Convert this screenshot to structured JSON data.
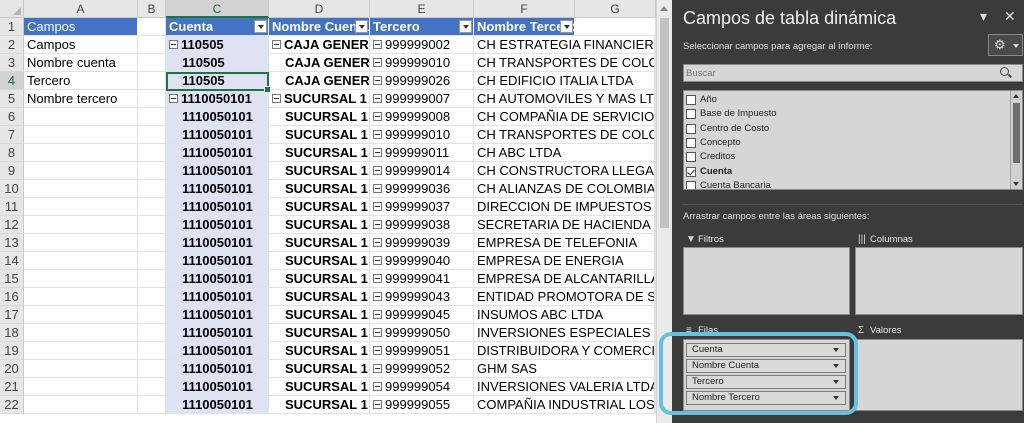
{
  "sheet": {
    "columns": [
      "A",
      "B",
      "C",
      "D",
      "E",
      "F",
      "G"
    ],
    "rows": [
      "1",
      "2",
      "3",
      "4",
      "5",
      "6",
      "7",
      "8",
      "9",
      "10",
      "11",
      "12",
      "13",
      "14",
      "15",
      "16",
      "17",
      "18",
      "19",
      "20",
      "21",
      "22"
    ],
    "selected_column": "C",
    "selected_row": "4",
    "colA": [
      "Campos",
      "Campos",
      "Nombre cuenta",
      "Tercero",
      "Nombre tercero"
    ],
    "pivot_headers": {
      "cuenta": "Cuenta",
      "nombre_cuenta": "Nombre Cuenta",
      "tercero": "Tercero",
      "nombre_tercero": "Nombre Tercero"
    },
    "pivot_rows": [
      {
        "cuenta": "110505",
        "nombre_cuenta": "CAJA GENERAL",
        "tercero": "999999002",
        "nombre_tercero": "CH ESTRATEGIA FINANCIERA S.A.S"
      },
      {
        "cuenta": "110505",
        "nombre_cuenta": "CAJA GENERAL",
        "tercero": "999999010",
        "nombre_tercero": "CH TRANSPORTES DE COLOMBIA"
      },
      {
        "cuenta": "110505",
        "nombre_cuenta": "CAJA GENERAL",
        "tercero": "999999026",
        "nombre_tercero": "CH EDIFICIO ITALIA LTDA"
      },
      {
        "cuenta": "1110050101",
        "nombre_cuenta": "SUCURSAL 1",
        "tercero": "999999007",
        "nombre_tercero": "CH AUTOMOVILES Y MAS LTDA"
      },
      {
        "cuenta": "1110050101",
        "nombre_cuenta": "SUCURSAL 1",
        "tercero": "999999008",
        "nombre_tercero": "CH COMPAÑIA DE SERVICIOS AEREOS"
      },
      {
        "cuenta": "1110050101",
        "nombre_cuenta": "SUCURSAL 1",
        "tercero": "999999010",
        "nombre_tercero": "CH TRANSPORTES DE COLOMBIA"
      },
      {
        "cuenta": "1110050101",
        "nombre_cuenta": "SUCURSAL 1",
        "tercero": "999999011",
        "nombre_tercero": "CH ABC LTDA"
      },
      {
        "cuenta": "1110050101",
        "nombre_cuenta": "SUCURSAL 1",
        "tercero": "999999014",
        "nombre_tercero": "CH CONSTRUCTORA LLEGANDO A"
      },
      {
        "cuenta": "1110050101",
        "nombre_cuenta": "SUCURSAL 1",
        "tercero": "999999036",
        "nombre_tercero": "CH ALIANZAS DE COLOMBIA LTDA"
      },
      {
        "cuenta": "1110050101",
        "nombre_cuenta": "SUCURSAL 1",
        "tercero": "999999037",
        "nombre_tercero": "DIRECCION DE IMPUESTOS Y ADUANAS"
      },
      {
        "cuenta": "1110050101",
        "nombre_cuenta": "SUCURSAL 1",
        "tercero": "999999038",
        "nombre_tercero": "SECRETARIA DE HACIENDA DISTRITAL"
      },
      {
        "cuenta": "1110050101",
        "nombre_cuenta": "SUCURSAL 1",
        "tercero": "999999039",
        "nombre_tercero": "EMPRESA DE TELEFONIA"
      },
      {
        "cuenta": "1110050101",
        "nombre_cuenta": "SUCURSAL 1",
        "tercero": "999999040",
        "nombre_tercero": "EMPRESA DE ENERGIA"
      },
      {
        "cuenta": "1110050101",
        "nombre_cuenta": "SUCURSAL 1",
        "tercero": "999999041",
        "nombre_tercero": "EMPRESA DE ALCANTARILLADO"
      },
      {
        "cuenta": "1110050101",
        "nombre_cuenta": "SUCURSAL 1",
        "tercero": "999999043",
        "nombre_tercero": "ENTIDAD PROMOTORA DE SALUD"
      },
      {
        "cuenta": "1110050101",
        "nombre_cuenta": "SUCURSAL 1",
        "tercero": "999999045",
        "nombre_tercero": "INSUMOS ABC LTDA"
      },
      {
        "cuenta": "1110050101",
        "nombre_cuenta": "SUCURSAL 1",
        "tercero": "999999050",
        "nombre_tercero": "INVERSIONES ESPECIALES LTDA"
      },
      {
        "cuenta": "1110050101",
        "nombre_cuenta": "SUCURSAL 1",
        "tercero": "999999051",
        "nombre_tercero": "DISTRIBUIDORA Y COMERCIALIZADORA"
      },
      {
        "cuenta": "1110050101",
        "nombre_cuenta": "SUCURSAL 1",
        "tercero": "999999052",
        "nombre_tercero": "GHM SAS"
      },
      {
        "cuenta": "1110050101",
        "nombre_cuenta": "SUCURSAL 1",
        "tercero": "999999054",
        "nombre_tercero": "INVERSIONES VALERIA LTDA"
      },
      {
        "cuenta": "1110050101",
        "nombre_cuenta": "SUCURSAL 1",
        "tercero": "999999055",
        "nombre_tercero": "COMPAÑIA INDUSTRIAL LOS PINOS"
      }
    ]
  },
  "pivot_pane": {
    "title": "Campos de tabla dinámica",
    "dropdown_glyph": "▾",
    "close_glyph": "✕",
    "subtitle": "Seleccionar campos para agregar al informe:",
    "settings_glyph": "⚙",
    "search_placeholder": "Buscar",
    "fields": [
      {
        "label": "Año",
        "checked": false
      },
      {
        "label": "Base de Impuesto",
        "checked": false
      },
      {
        "label": "Centro de Costo",
        "checked": false
      },
      {
        "label": "Concepto",
        "checked": false
      },
      {
        "label": "Creditos",
        "checked": false
      },
      {
        "label": "Cuenta",
        "checked": true
      },
      {
        "label": "Cuenta Bancaria",
        "checked": false
      }
    ],
    "drag_hint": "Arrastrar campos entre las áreas siguientes:",
    "areas": {
      "filters": {
        "label": "Filtros",
        "icon": "filter-icon"
      },
      "columns": {
        "label": "Columnas",
        "icon": "columns-icon"
      },
      "rows": {
        "label": "Filas",
        "icon": "rows-icon",
        "items": [
          "Cuenta",
          "Nombre Cuenta",
          "Tercero",
          "Nombre Tercero"
        ]
      },
      "values": {
        "label": "Valores",
        "icon": "sigma-icon"
      }
    },
    "accent_color": "#66c0e0"
  }
}
